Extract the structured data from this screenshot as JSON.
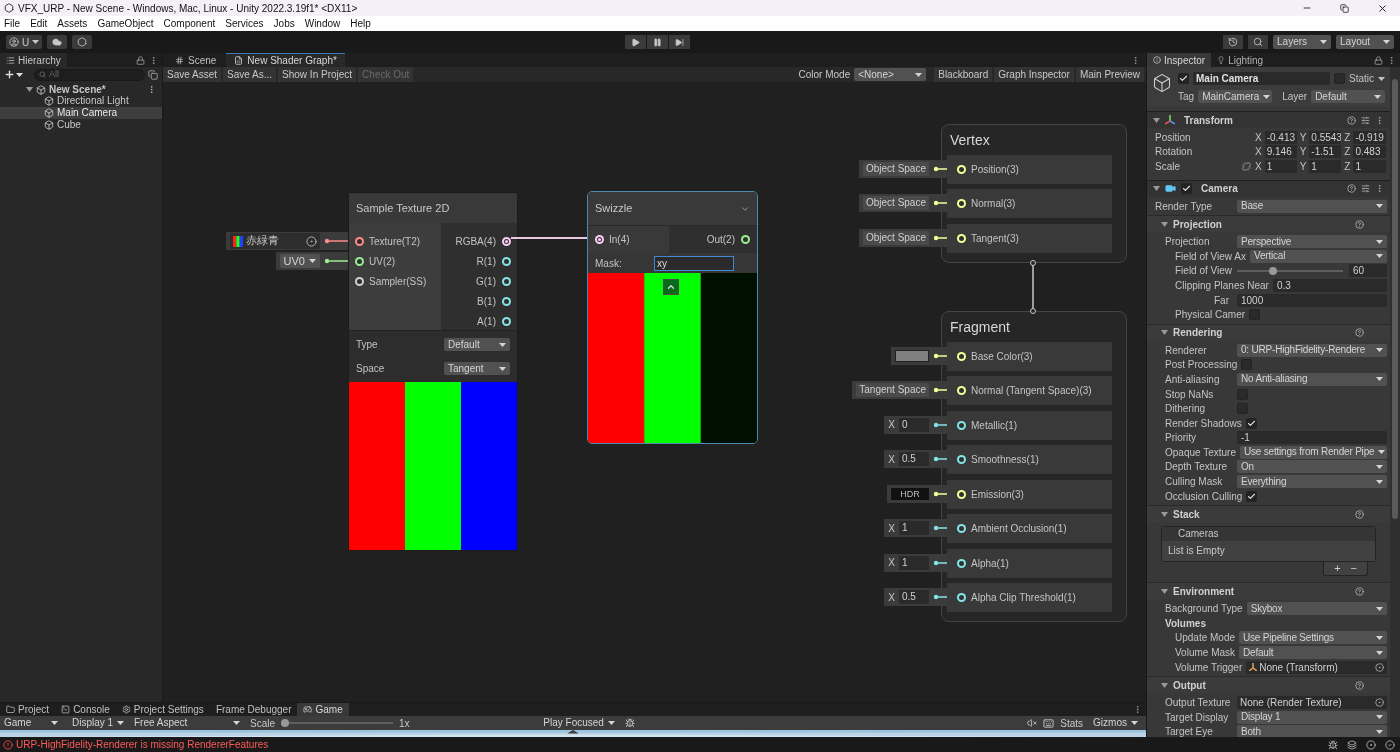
{
  "window": {
    "title": "VFX_URP - New Scene - Windows, Mac, Linux - Unity 2022.3.19f1* <DX11>"
  },
  "menu": [
    "File",
    "Edit",
    "Assets",
    "GameObject",
    "Component",
    "Services",
    "Jobs",
    "Window",
    "Help"
  ],
  "toolbar": {
    "account": "U",
    "layers": "Layers",
    "layout": "Layout"
  },
  "hierarchy": {
    "title": "Hierarchy",
    "search_placeholder": "All",
    "items": [
      {
        "label": "New Scene*",
        "expanded": true,
        "selected": false,
        "children": [
          {
            "label": "Directional Light",
            "selected": false
          },
          {
            "label": "Main Camera",
            "selected": true
          },
          {
            "label": "Cube",
            "selected": false
          }
        ]
      }
    ]
  },
  "graph_tabs": [
    {
      "label": "Scene",
      "selected": false
    },
    {
      "label": "New Shader Graph*",
      "selected": true
    }
  ],
  "graph_toolbar": {
    "buttons": [
      {
        "label": "Save Asset",
        "disabled": false
      },
      {
        "label": "Save As...",
        "disabled": false
      },
      {
        "label": "Show In Project",
        "disabled": false
      },
      {
        "label": "Check Out",
        "disabled": true
      }
    ],
    "color_mode_label": "Color Mode",
    "color_mode": "<None>",
    "panels": [
      "Blackboard",
      "Graph Inspector",
      "Main Preview"
    ]
  },
  "sample_node": {
    "title": "Sample Texture 2D",
    "inputs": [
      {
        "label": "Texture(T2)",
        "color": "#ff8b8b",
        "chip": {
          "kind": "texture",
          "value": "赤緑青"
        }
      },
      {
        "label": "UV(2)",
        "color": "#9aef92",
        "chip": {
          "kind": "dropdown",
          "value": "UV0"
        }
      },
      {
        "label": "Sampler(SS)",
        "color": "#cfcfcf"
      }
    ],
    "outputs": [
      {
        "label": "RGBA(4)",
        "color": "#fbcbf4",
        "connected": true
      },
      {
        "label": "R(1)",
        "color": "#84e4e7",
        "connected": false
      },
      {
        "label": "G(1)",
        "color": "#84e4e7",
        "connected": false
      },
      {
        "label": "B(1)",
        "color": "#84e4e7",
        "connected": false
      },
      {
        "label": "A(1)",
        "color": "#84e4e7",
        "connected": false
      }
    ],
    "settings": [
      {
        "label": "Type",
        "value": "Default"
      },
      {
        "label": "Space",
        "value": "Tangent"
      }
    ]
  },
  "swizzle_node": {
    "title": "Swizzle",
    "selected": true,
    "input": {
      "label": "In(4)",
      "color": "#fbcbf4",
      "connected": true
    },
    "output": {
      "label": "Out(2)",
      "color": "#9aef92",
      "connected": false
    },
    "mask_label": "Mask:",
    "mask": "xy"
  },
  "contexts": [
    {
      "title": "Vertex",
      "blocks": [
        {
          "label": "Position(3)",
          "color": "#f6ff9a",
          "input": {
            "kind": "dropdown",
            "value": "Object Space"
          }
        },
        {
          "label": "Normal(3)",
          "color": "#f6ff9a",
          "input": {
            "kind": "dropdown",
            "value": "Object Space"
          }
        },
        {
          "label": "Tangent(3)",
          "color": "#f6ff9a",
          "input": {
            "kind": "dropdown",
            "value": "Object Space"
          }
        }
      ]
    },
    {
      "title": "Fragment",
      "blocks": [
        {
          "label": "Base Color(3)",
          "color": "#f6ff9a",
          "input": {
            "kind": "swatch"
          }
        },
        {
          "label": "Normal (Tangent Space)(3)",
          "color": "#f6ff9a",
          "input": {
            "kind": "dropdown",
            "value": "Tangent Space"
          }
        },
        {
          "label": "Metallic(1)",
          "color": "#84e4e7",
          "input": {
            "kind": "number",
            "axis": "X",
            "value": "0"
          }
        },
        {
          "label": "Smoothness(1)",
          "color": "#84e4e7",
          "input": {
            "kind": "number",
            "axis": "X",
            "value": "0.5"
          }
        },
        {
          "label": "Emission(3)",
          "color": "#f6ff9a",
          "input": {
            "kind": "hdr",
            "value": "HDR"
          }
        },
        {
          "label": "Ambient Occlusion(1)",
          "color": "#84e4e7",
          "input": {
            "kind": "number",
            "axis": "X",
            "value": "1"
          }
        },
        {
          "label": "Alpha(1)",
          "color": "#84e4e7",
          "input": {
            "kind": "number",
            "axis": "X",
            "value": "1"
          }
        },
        {
          "label": "Alpha Clip Threshold(1)",
          "color": "#84e4e7",
          "input": {
            "kind": "number",
            "axis": "X",
            "value": "0.5"
          }
        }
      ]
    }
  ],
  "inspector": {
    "tabs": [
      {
        "label": "Inspector",
        "selected": true
      },
      {
        "label": "Lighting",
        "selected": false
      }
    ],
    "object": {
      "active": true,
      "name": "Main Camera",
      "static": false,
      "static_label": "Static",
      "tag_label": "Tag",
      "tag": "MainCamera",
      "layer_label": "Layer",
      "layer": "Default"
    },
    "transform": {
      "title": "Transform",
      "rows": [
        {
          "label": "Position",
          "linked": false,
          "values": [
            {
              "axis": "X",
              "value": "-0.413"
            },
            {
              "axis": "Y",
              "value": "0.5543"
            },
            {
              "axis": "Z",
              "value": "-0.919"
            }
          ]
        },
        {
          "label": "Rotation",
          "linked": false,
          "values": [
            {
              "axis": "X",
              "value": "9.146"
            },
            {
              "axis": "Y",
              "value": "-1.51"
            },
            {
              "axis": "Z",
              "value": "0.483"
            }
          ]
        },
        {
          "label": "Scale",
          "linked": true,
          "values": [
            {
              "axis": "X",
              "value": "1"
            },
            {
              "axis": "Y",
              "value": "1"
            },
            {
              "axis": "Z",
              "value": "1"
            }
          ]
        }
      ]
    },
    "camera": {
      "title": "Camera",
      "enabled": true,
      "rows": [
        {
          "kind": "dropdown",
          "label": "Render Type",
          "value": "Base"
        }
      ],
      "foldouts": [
        {
          "title": "Projection",
          "expanded": true,
          "rows": [
            {
              "kind": "dropdown",
              "label": "Projection",
              "value": "Perspective",
              "children": [
                {
                  "kind": "dropdown",
                  "label": "Field of View Ax",
                  "value": "Vertical"
                },
                {
                  "kind": "slider",
                  "label": "Field of View",
                  "level": 0.33,
                  "value": "60"
                },
                {
                  "kind": "field",
                  "label": "Clipping Planes Near",
                  "value": "0.3"
                },
                {
                  "kind": "subfield",
                  "label": "Far",
                  "value": "1000"
                },
                {
                  "kind": "checkbox",
                  "label": "Physical Camer",
                  "checked": false
                }
              ]
            }
          ]
        },
        {
          "title": "Rendering",
          "expanded": true,
          "rows": [
            {
              "kind": "dropdown",
              "label": "Renderer",
              "value": "0: URP-HighFidelity-Rendere"
            },
            {
              "kind": "checkbox",
              "label": "Post Processing",
              "checked": false
            },
            {
              "kind": "dropdown",
              "label": "Anti-aliasing",
              "value": "No Anti-aliasing"
            },
            {
              "kind": "checkbox",
              "label": "Stop NaNs",
              "checked": false
            },
            {
              "kind": "checkbox",
              "label": "Dithering",
              "checked": false
            },
            {
              "kind": "checkbox",
              "label": "Render Shadows",
              "checked": true
            },
            {
              "kind": "field",
              "label": "Priority",
              "value": "-1"
            },
            {
              "kind": "dropdown",
              "label": "Opaque Texture",
              "value": "Use settings from Render Pipe"
            },
            {
              "kind": "dropdown",
              "label": "Depth Texture",
              "value": "On"
            },
            {
              "kind": "dropdown",
              "label": "Culling Mask",
              "value": "Everything"
            },
            {
              "kind": "checkbox",
              "label": "Occlusion Culling",
              "checked": true
            }
          ]
        },
        {
          "title": "Stack",
          "expanded": true,
          "rows": [
            {
              "kind": "list",
              "label": "Cameras",
              "empty": "List is Empty",
              "add": "+",
              "remove": "−"
            }
          ]
        },
        {
          "title": "Environment",
          "expanded": true,
          "rows": [
            {
              "kind": "dropdown",
              "label": "Background Type",
              "value": "Skybox"
            },
            {
              "kind": "group",
              "label": "Volumes",
              "children": [
                {
                  "kind": "dropdown",
                  "label": "Update Mode",
                  "value": "Use Pipeline Settings"
                },
                {
                  "kind": "dropdown",
                  "label": "Volume Mask",
                  "value": "Default"
                },
                {
                  "kind": "object",
                  "label": "Volume Trigger",
                  "value": "None (Transform)",
                  "icon": true
                }
              ]
            }
          ]
        },
        {
          "title": "Output",
          "expanded": true,
          "rows": [
            {
              "kind": "object",
              "label": "Output Texture",
              "value": "None (Render Texture)",
              "icon": false
            },
            {
              "kind": "dropdown",
              "label": "Target Display",
              "value": "Display 1"
            },
            {
              "kind": "dropdown",
              "label": "Target Eye",
              "value": "Both"
            }
          ]
        }
      ]
    }
  },
  "bottom_tabs": [
    {
      "label": "Project",
      "selected": false
    },
    {
      "label": "Console",
      "selected": false
    },
    {
      "label": "Project Settings",
      "selected": false
    },
    {
      "label": "Frame Debugger",
      "selected": false
    },
    {
      "label": "Game",
      "selected": true
    }
  ],
  "game_toolbar": {
    "view": "Game",
    "display": "Display 1",
    "aspect": "Free Aspect",
    "scale_label": "Scale",
    "level": 0.0,
    "scale_value": "1x",
    "play_mode": "Play Focused",
    "stats": "Stats",
    "gizmos": "Gizmos"
  },
  "status": {
    "message": "URP-HighFidelity-Renderer is missing RendererFeatures"
  }
}
